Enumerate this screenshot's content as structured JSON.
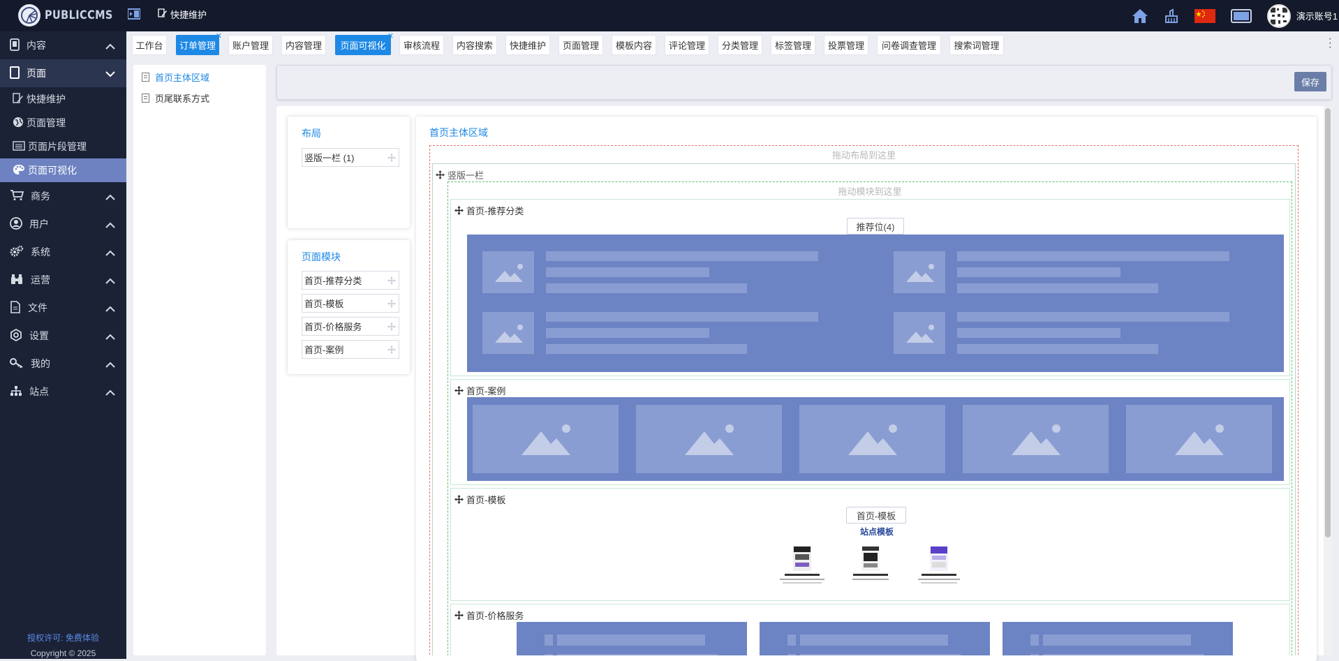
{
  "header": {
    "brand": "PUBLICCMS",
    "breadcrumb": "快捷维护",
    "username": "演示账号1"
  },
  "sidebar": {
    "groups": [
      {
        "label": "内容",
        "icon": "phone-icon"
      },
      {
        "label": "页面",
        "icon": "tablet-icon"
      },
      {
        "label": "商务",
        "icon": "cart-icon"
      },
      {
        "label": "用户",
        "icon": "user-icon"
      },
      {
        "label": "系统",
        "icon": "cogs-icon"
      },
      {
        "label": "运营",
        "icon": "binoculars-icon"
      },
      {
        "label": "文件",
        "icon": "file-icon"
      },
      {
        "label": "设置",
        "icon": "settings-icon"
      },
      {
        "label": "我的",
        "icon": "key-icon"
      },
      {
        "label": "站点",
        "icon": "sitemap-icon"
      }
    ],
    "page_sub": [
      {
        "label": "快捷维护"
      },
      {
        "label": "页面管理"
      },
      {
        "label": "页面片段管理"
      },
      {
        "label": "页面可视化"
      }
    ],
    "license": "授权许可: 免费体验",
    "copyright": "Copyright © 2025"
  },
  "tabs": [
    {
      "label": "工作台"
    },
    {
      "label": "订单管理"
    },
    {
      "label": "账户管理"
    },
    {
      "label": "内容管理"
    },
    {
      "label": "页面可视化"
    },
    {
      "label": "审核流程"
    },
    {
      "label": "内容搜索"
    },
    {
      "label": "快捷维护"
    },
    {
      "label": "页面管理"
    },
    {
      "label": "模板内容"
    },
    {
      "label": "评论管理"
    },
    {
      "label": "分类管理"
    },
    {
      "label": "标签管理"
    },
    {
      "label": "投票管理"
    },
    {
      "label": "问卷调查管理"
    },
    {
      "label": "搜索词管理"
    }
  ],
  "tree": {
    "items": [
      {
        "label": "首页主体区域"
      },
      {
        "label": "页尾联系方式"
      }
    ]
  },
  "toolbar": {
    "save_label": "保存"
  },
  "layout_panel": {
    "title": "布局",
    "items": [
      {
        "label": "竖版一栏 (1)"
      }
    ]
  },
  "module_panel": {
    "title": "页面模块",
    "items": [
      {
        "label": "首页-推荐分类"
      },
      {
        "label": "首页-模板"
      },
      {
        "label": "首页-价格服务"
      },
      {
        "label": "首页-案例"
      }
    ]
  },
  "visual": {
    "title": "首页主体区域",
    "drop_layout_hint": "拖动布局到这里",
    "column_label": "竖版一栏",
    "drop_module_hint": "拖动模块到这里",
    "blocks": [
      {
        "label": "首页-推荐分类",
        "tag": "推荐位(4)"
      },
      {
        "label": "首页-案例"
      },
      {
        "label": "首页-模板",
        "tag": "首页-模板",
        "subtitle": "站点模板"
      },
      {
        "label": "首页-价格服务"
      }
    ]
  },
  "colors": {
    "accent": "#1e88e5",
    "sidebar_bg": "#1b2236",
    "header_bg": "#141a2b",
    "placeholder_block": "#6c83c4"
  }
}
